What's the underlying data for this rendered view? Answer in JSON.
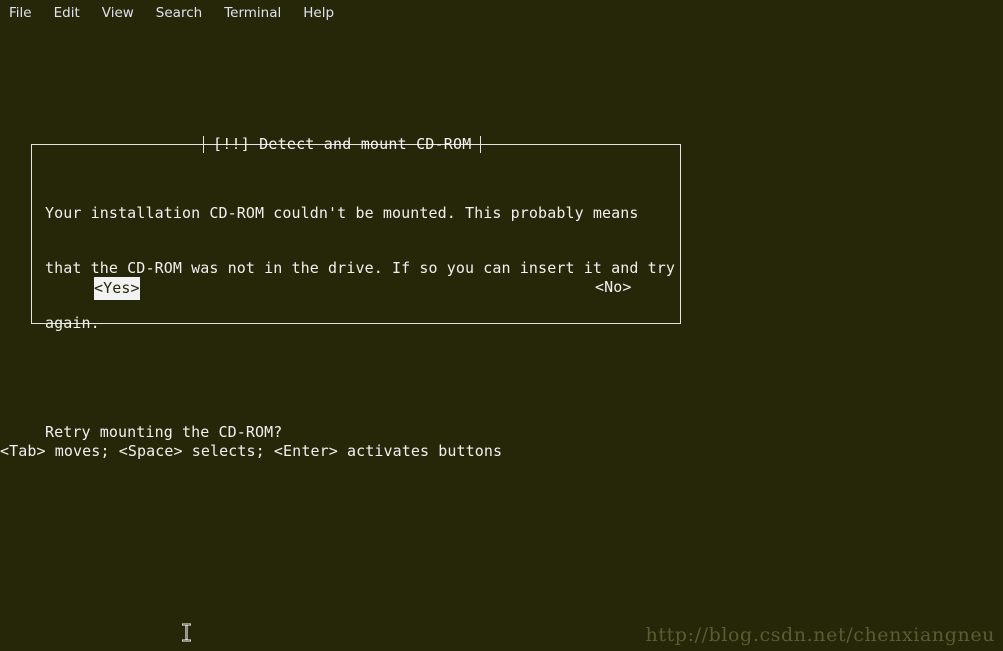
{
  "colors": {
    "background": "#262608",
    "foreground": "#f0f0f0",
    "menu_text": "#dfe3f0",
    "border": "#e3e3e3",
    "selection_bg": "#f2f2f2",
    "selection_fg": "#262608",
    "watermark": "#5c5c33"
  },
  "menubar": {
    "items": [
      {
        "label": "File"
      },
      {
        "label": "Edit"
      },
      {
        "label": "View"
      },
      {
        "label": "Search"
      },
      {
        "label": "Terminal"
      },
      {
        "label": "Help"
      }
    ]
  },
  "dialog": {
    "title": "[!!] Detect and mount CD-ROM",
    "body_lines": [
      "Your installation CD-ROM couldn't be mounted. This probably means",
      "that the CD-ROM was not in the drive. If so you can insert it and try",
      "again."
    ],
    "question": "Retry mounting the CD-ROM?",
    "buttons": [
      {
        "label": "<Yes>",
        "selected": true,
        "cursor_char": "<",
        "rest": "Yes>"
      },
      {
        "label": "<No>",
        "selected": false
      }
    ]
  },
  "help_line": "<Tab> moves; <Space> selects; <Enter> activates buttons",
  "watermark": "http://blog.csdn.net/chenxiangneu"
}
